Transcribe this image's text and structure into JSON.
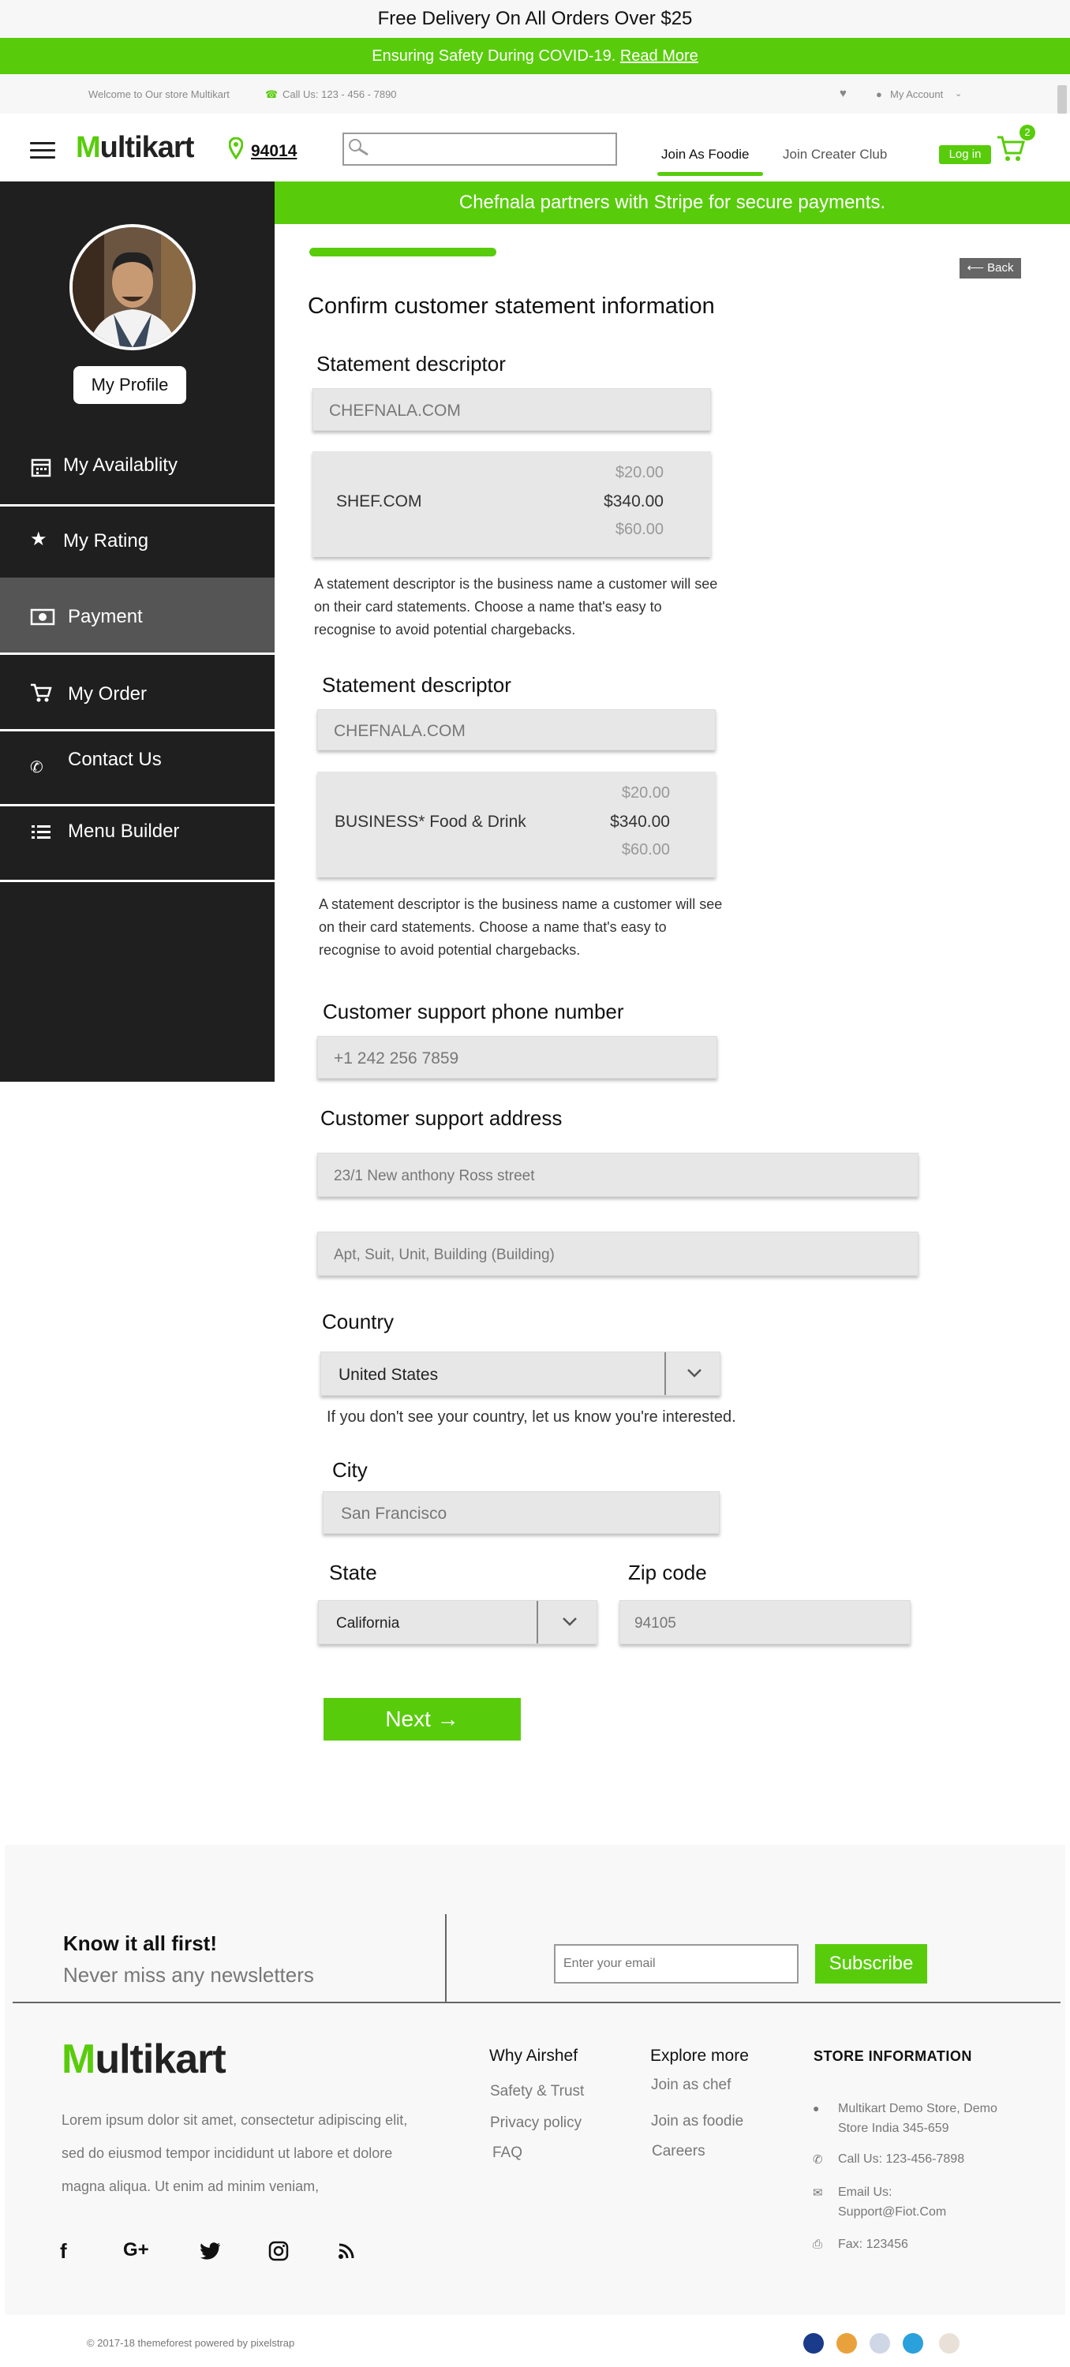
{
  "top_banner": {
    "text": "Free Delivery On All Orders Over $25"
  },
  "covid_banner": {
    "text": "Ensuring Safety During COVID-19.",
    "link": "Read More"
  },
  "info_bar": {
    "welcome": "Welcome to Our store Multikart",
    "call": "Call Us: 123 - 456 - 7890",
    "account": "My Account"
  },
  "header": {
    "logo_m": "M",
    "logo_text": "ultikart",
    "zip": "94014",
    "search_placeholder": "",
    "nav": [
      "Join As Foodie",
      "Join Creater Club"
    ],
    "login": "Log in",
    "cart_count": "2"
  },
  "sidebar": {
    "profile_button": "My Profile",
    "items": [
      {
        "label": "My Availablity",
        "icon": "calendar-icon"
      },
      {
        "label": "My Rating",
        "icon": "star-icon"
      },
      {
        "label": "Payment",
        "icon": "money-icon"
      },
      {
        "label": "My Order",
        "icon": "cart-icon"
      },
      {
        "label": "Contact Us",
        "icon": "phone-icon"
      },
      {
        "label": "Menu Builder",
        "icon": "list-icon"
      }
    ],
    "active": "Payment"
  },
  "stripe_banner": "Chefnala partners with Stripe for secure payments.",
  "form": {
    "back": "Back",
    "title": "Confirm customer statement information",
    "section1": {
      "heading": "Statement descriptor",
      "value": "CHEFNALA.COM",
      "preview_name": "SHEF.COM",
      "amounts": [
        "$20.00",
        "$340.00",
        "$60.00"
      ],
      "description": "A statement descriptor is the business name a customer will see on their card statements. Choose a name that's easy to recognise to avoid potential chargebacks."
    },
    "section2": {
      "heading": "Statement descriptor",
      "value": "CHEFNALA.COM",
      "preview_name": "BUSINESS* Food & Drink",
      "amounts": [
        "$20.00",
        "$340.00",
        "$60.00"
      ],
      "description": "A statement descriptor is the business name a customer will see on their card statements. Choose a name that's easy to recognise to avoid potential chargebacks."
    },
    "phone": {
      "heading": "Customer support phone number",
      "value": "+1 242 256 7859"
    },
    "address": {
      "heading": "Customer support address",
      "line1": "23/1 New anthony Ross street",
      "line2": "Apt, Suit, Unit, Building (Building)"
    },
    "country": {
      "heading": "Country",
      "value": "United States",
      "note": "If you don't see your country, let us know you're interested."
    },
    "city": {
      "heading": "City",
      "value": "San Francisco"
    },
    "state": {
      "heading": "State",
      "value": "California"
    },
    "zip": {
      "heading": "Zip code",
      "value": "94105"
    },
    "next": "Next →"
  },
  "footer": {
    "newsletter_title": "Know it all first!",
    "newsletter_sub": "Never miss any newsletters",
    "email_placeholder": "Enter your email",
    "subscribe": "Subscribe",
    "about": "Lorem ipsum dolor sit amet, consectetur adipiscing elit, sed do eiusmod tempor incididunt ut labore et dolore magna aliqua. Ut enim ad minim veniam,",
    "col1_title": "Why Airshef",
    "col1": [
      "Safety & Trust",
      "Privacy policy",
      "FAQ"
    ],
    "col2_title": "Explore more",
    "col2": [
      "Join as chef",
      "Join as foodie",
      "Careers"
    ],
    "store_title": "STORE INFORMATION",
    "store_address": "Multikart Demo Store, Demo Store India 345-659",
    "store_call": "Call Us: 123-456-7898",
    "store_email": "Email Us: Support@Fiot.Com",
    "store_fax": "Fax: 123456",
    "copyright": "© 2017-18 themeforest powered by pixelstrap"
  },
  "colors": {
    "accent": "#58cc0b",
    "sidebar": "#1f1f1f"
  }
}
